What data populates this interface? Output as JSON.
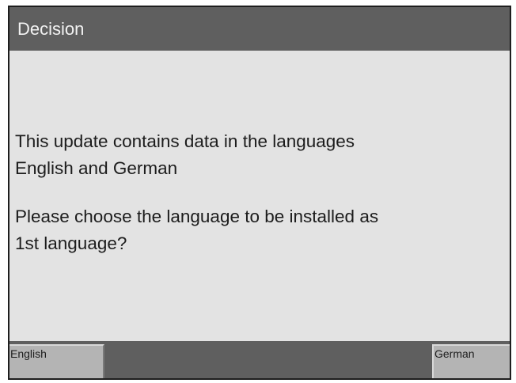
{
  "dialog": {
    "title": "Decision",
    "message_line1": "This update contains data in the languages\nEnglish and German",
    "message_line2": "Please choose the language to be installed as\n1st language?"
  },
  "buttons": {
    "left_label": "English",
    "right_label": "German"
  },
  "colors": {
    "titlebar": "#5f5f5f",
    "content_bg": "#e3e3e3",
    "button_bg": "#b4b4b4",
    "frame_border": "#1e1e1e"
  }
}
